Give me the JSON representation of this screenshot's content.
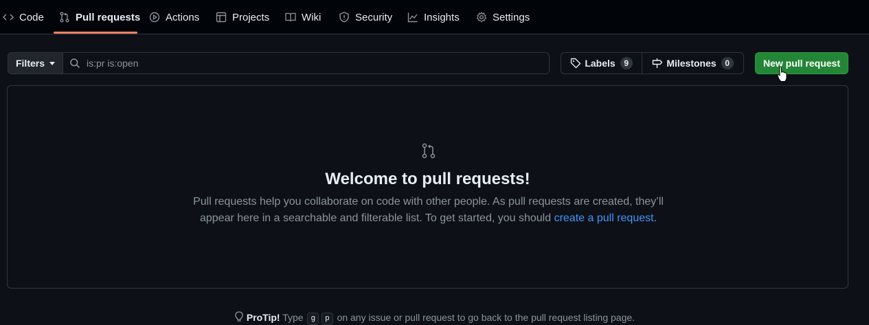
{
  "nav": {
    "tabs": [
      {
        "label": "Code",
        "icon": "code-icon"
      },
      {
        "label": "Pull requests",
        "icon": "git-pull-request-icon",
        "active": true
      },
      {
        "label": "Actions",
        "icon": "play-icon"
      },
      {
        "label": "Projects",
        "icon": "table-icon"
      },
      {
        "label": "Wiki",
        "icon": "book-icon"
      },
      {
        "label": "Security",
        "icon": "shield-icon"
      },
      {
        "label": "Insights",
        "icon": "graph-icon"
      },
      {
        "label": "Settings",
        "icon": "gear-icon"
      }
    ],
    "active_underline_color": "#f78166"
  },
  "toolbar": {
    "filters_label": "Filters",
    "search_placeholder": "is:pr is:open",
    "labels_label": "Labels",
    "labels_count": "9",
    "milestones_label": "Milestones",
    "milestones_count": "0",
    "new_pr_label": "New pull request"
  },
  "blankslate": {
    "title": "Welcome to pull requests!",
    "text_line1": "Pull requests help you collaborate on code with other people. As pull requests are created, they’ll",
    "text_line2": "appear here in a searchable and filterable list. To get started, you should",
    "link_text": "create a pull request",
    "text_end": "."
  },
  "protip": {
    "label": "ProTip!",
    "prefix": "Type",
    "key1": "g",
    "key2": "p",
    "suffix": "on any issue or pull request to go back to the pull request listing page."
  },
  "colors": {
    "background": "#0d1117",
    "nav_background": "#010409",
    "primary_button": "#238636",
    "link": "#4493f8",
    "border": "#30363d"
  }
}
